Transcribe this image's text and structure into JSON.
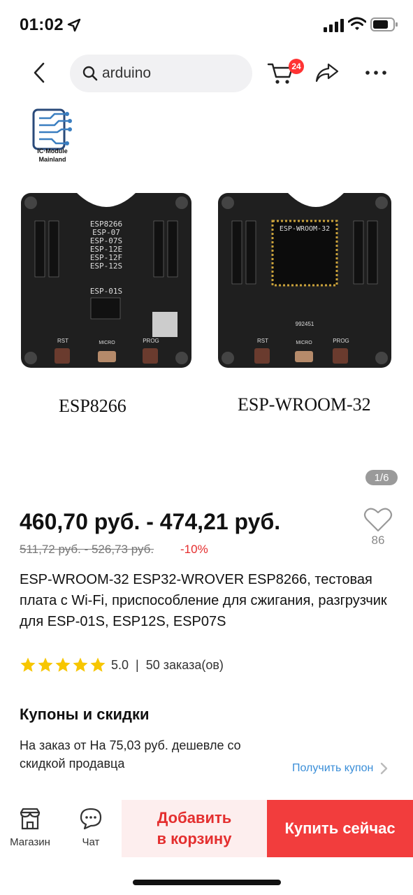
{
  "status_bar": {
    "time": "01:02"
  },
  "header": {
    "search_text": "arduino",
    "cart_count": "24"
  },
  "gallery": {
    "brand_caption_line1": "IC·Module",
    "brand_caption_line2": "Mainland",
    "board_a_caption": "ESP8266",
    "board_b_caption": "ESP-WROOM-32",
    "board_a_labels": [
      "ESP8266",
      "ESP-07",
      "ESP-07S",
      "ESP-12E",
      "ESP-12F",
      "ESP-12S",
      "ESP-01S",
      "RST",
      "MICRO",
      "PROG"
    ],
    "board_b_labels": [
      "ESP-WROOM-32",
      "992451",
      "RST",
      "MICRO",
      "PROG"
    ],
    "page_indicator": "1/6"
  },
  "product": {
    "price": "460,70 руб. - 474,21 руб.",
    "old_price": "511,72 руб. - 526,73 руб.",
    "discount": "-10%",
    "wish_count": "86",
    "title": "ESP-WROOM-32 ESP32-WROVER ESP8266, тестовая плата с Wi-Fi, приспособление для сжигания, разгрузчик для ESP-01S, ESP12S, ESP07S",
    "rating": "5.0",
    "rating_stars": 5,
    "rating_separator": "|",
    "orders": "50 заказа(ов)"
  },
  "coupons": {
    "title": "Купоны и скидки",
    "text": "На заказ от На 75,03 руб. дешевле со скидкой продавца",
    "link": "Получить купон"
  },
  "bottom_bar": {
    "store_label": "Магазин",
    "chat_label": "Чат",
    "add_to_cart": "Добавить в корзину",
    "buy_now": "Купить сейчас"
  },
  "colors": {
    "accent_red": "#f23d3d",
    "discount_red": "#e52d2d",
    "link_blue": "#3a8ed8",
    "star_yellow": "#f7c600",
    "badge_red": "#ff3333"
  },
  "icons": [
    "location-arrow-icon",
    "signal-icon",
    "wifi-icon",
    "battery-icon",
    "back-icon",
    "search-icon",
    "cart-icon",
    "share-icon",
    "more-icon",
    "heart-icon",
    "star-icon",
    "chevron-right-icon",
    "store-icon",
    "chat-icon"
  ]
}
